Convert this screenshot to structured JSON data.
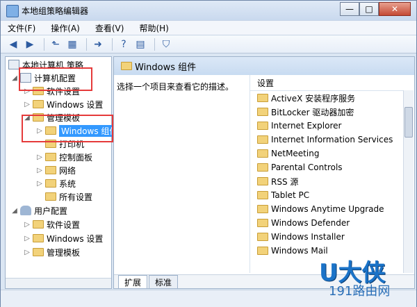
{
  "window": {
    "title": "本地组策略编辑器",
    "minimize": "—",
    "maximize": "□",
    "close": "✕"
  },
  "menu": {
    "items": [
      "文件(F)",
      "操作(A)",
      "查看(V)",
      "帮助(H)"
    ]
  },
  "toolbar": {
    "icons": [
      "back-arrow-icon",
      "forward-arrow-icon",
      "up-folder-icon",
      "show-hide-tree-icon",
      "export-list-icon",
      "help-icon",
      "properties-icon",
      "filter-icon"
    ],
    "glyphs": [
      "◀",
      "▶",
      "⬑",
      "▦",
      "➜",
      "?",
      "▤",
      "⛉"
    ]
  },
  "tree": {
    "root": "本地计算机 策略",
    "computer_config": "计算机配置",
    "software_settings_1": "软件设置",
    "windows_settings_1": "Windows 设置",
    "admin_templates_1": "管理模板",
    "windows_components": "Windows 组件",
    "printers": "打印机",
    "control_panel": "控制面板",
    "network": "网络",
    "system": "系统",
    "all_settings": "所有设置",
    "user_config": "用户配置",
    "software_settings_2": "软件设置",
    "windows_settings_2": "Windows 设置",
    "admin_templates_2": "管理模板"
  },
  "right": {
    "header": "Windows 组件",
    "description": "选择一个项目来查看它的描述。",
    "list_header": "设置",
    "items": [
      "ActiveX 安装程序服务",
      "BitLocker 驱动器加密",
      "Internet Explorer",
      "Internet Information Services",
      "NetMeeting",
      "Parental Controls",
      "RSS 源",
      "Tablet PC",
      "Windows Anytime Upgrade",
      "Windows Defender",
      "Windows Installer",
      "Windows Mail"
    ]
  },
  "tabs": [
    "扩展",
    "标准"
  ],
  "watermark": {
    "big": "U大侠",
    "small": "191路由网"
  },
  "colors": {
    "highlight_box": "#e53a3a",
    "selection": "#3399ff",
    "folder": "#f2d27a"
  }
}
